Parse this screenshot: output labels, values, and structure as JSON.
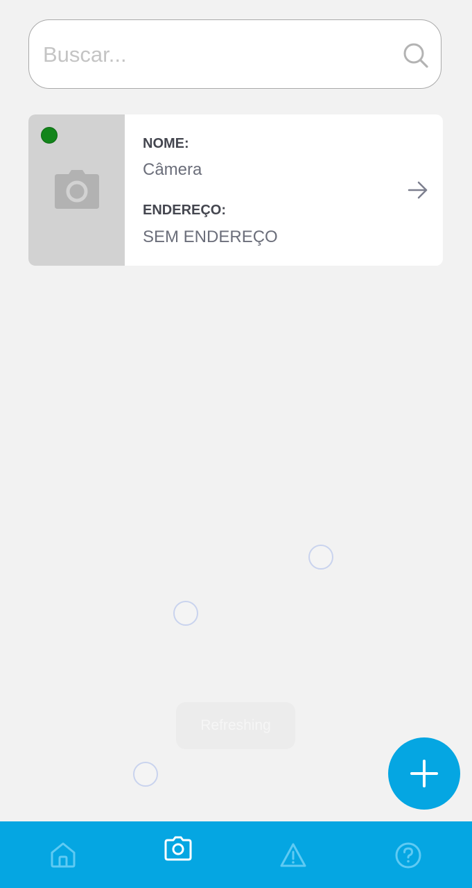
{
  "search": {
    "placeholder": "Buscar...",
    "value": "",
    "icon": "search-icon"
  },
  "devices": [
    {
      "status": "online",
      "status_color": "#13851b",
      "thumbnail_icon": "camera-icon",
      "name_label": "NOME:",
      "name": "Câmera",
      "address_label": "ENDEREÇO:",
      "address": "SEM ENDEREÇO",
      "action_icon": "arrow-right-icon"
    }
  ],
  "toast": {
    "text": "Refreshing"
  },
  "fab": {
    "icon": "plus-icon",
    "color": "#05a6e2"
  },
  "bottom_nav": {
    "color": "#05a6e2",
    "items": [
      {
        "icon": "home-icon",
        "active": false
      },
      {
        "icon": "camera-icon",
        "active": true
      },
      {
        "icon": "warning-icon",
        "active": false
      },
      {
        "icon": "help-icon",
        "active": false
      }
    ]
  }
}
